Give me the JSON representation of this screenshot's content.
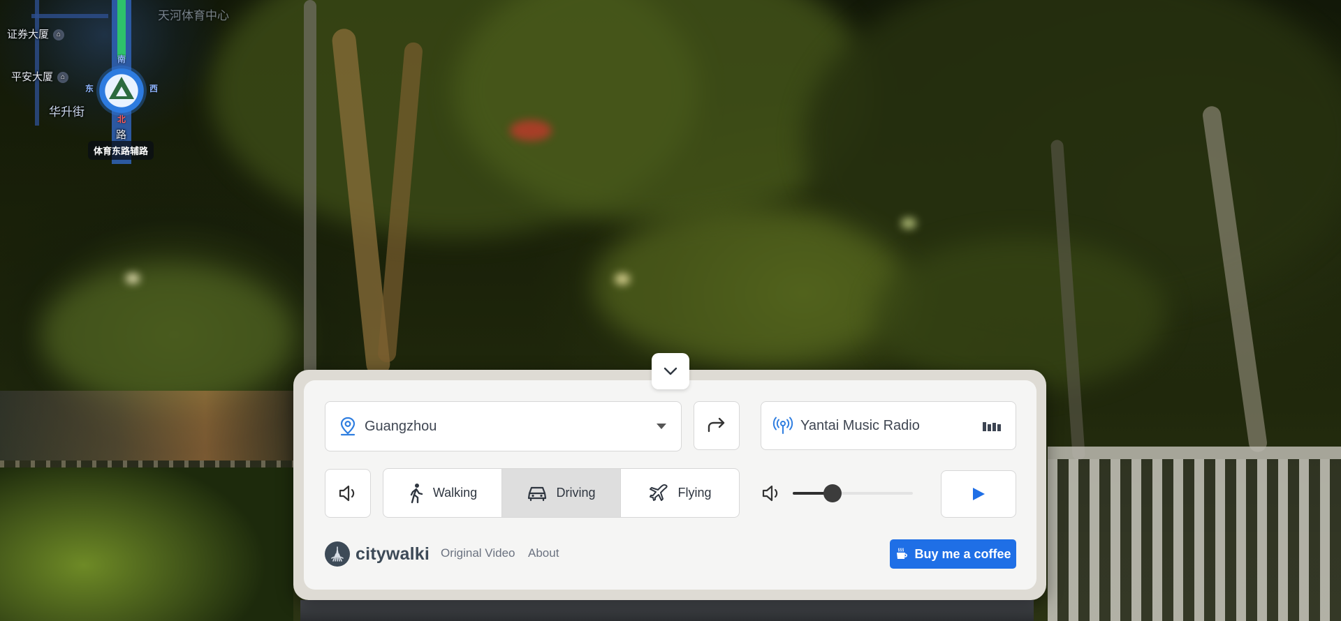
{
  "map": {
    "labels": [
      "证券大厦",
      "平安大厦",
      "华升街"
    ],
    "compass": {
      "north": "北",
      "east": "东",
      "west": "西",
      "south": "南"
    },
    "vertical_road_label": "路",
    "street_name": "体育东路辅路",
    "blurred_text": "天河体育中心"
  },
  "panel": {
    "city": {
      "value": "Guangzhou",
      "icon": "map-pin-icon"
    },
    "radio": {
      "station": "Yantai Music Radio",
      "icon": "radio-broadcast-icon"
    },
    "modes": [
      {
        "label": "Walking",
        "icon": "walking-person-icon",
        "active": false
      },
      {
        "label": "Driving",
        "icon": "car-icon",
        "active": true
      },
      {
        "label": "Flying",
        "icon": "airplane-icon",
        "active": false
      }
    ],
    "volume": {
      "level_percent": 33
    },
    "brand": {
      "name": "citywalki"
    },
    "links": {
      "original_video": "Original Video",
      "about": "About"
    },
    "coffee_button": "Buy me a coffee"
  },
  "colors": {
    "accent": "#1f6fe6",
    "panel_bg": "#f5f5f4",
    "active_mode_bg": "#dedede"
  }
}
